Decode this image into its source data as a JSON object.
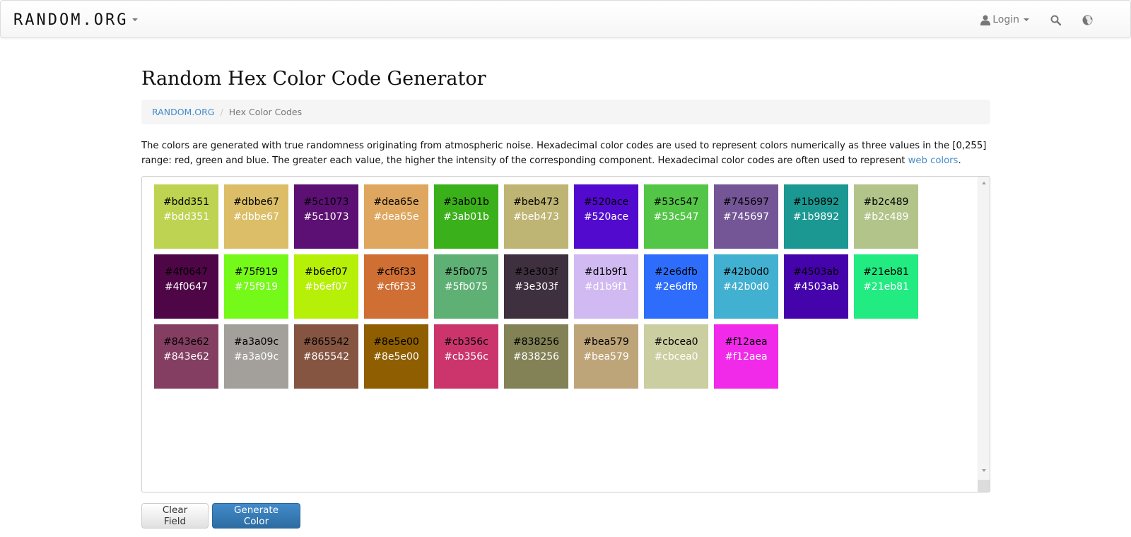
{
  "navbar": {
    "brand": "RANDOM.ORG",
    "login_label": "Login",
    "icons": [
      "user-icon",
      "search-icon",
      "globe-icon"
    ]
  },
  "page": {
    "title": "Random Hex Color Code Generator",
    "breadcrumb": {
      "home": "RANDOM.ORG",
      "separator": "/",
      "current": "Hex Color Codes"
    },
    "description_text": "The colors are generated with true randomness originating from atmospheric noise. Hexadecimal color codes are used to represent colors numerically as three values in the [0,255] range: red, green and blue. The greater each value, the higher the intensity of the corresponding component. Hexadecimal color codes are often used to represent ",
    "description_link": "web colors",
    "description_end": "."
  },
  "colors": [
    "#bdd351",
    "#dbbe67",
    "#5c1073",
    "#dea65e",
    "#3ab01b",
    "#beb473",
    "#520ace",
    "#53c547",
    "#745697",
    "#1b9892",
    "#b2c489",
    "#4f0647",
    "#75f919",
    "#b6ef07",
    "#cf6f33",
    "#5fb075",
    "#3e303f",
    "#d1b9f1",
    "#2e6dfb",
    "#42b0d0",
    "#4503ab",
    "#21eb81",
    "#843e62",
    "#a3a09c",
    "#865542",
    "#8e5e00",
    "#cb356c",
    "#838256",
    "#bea579",
    "#cbcea0",
    "#f12aea"
  ],
  "buttons": {
    "clear": "Clear Field",
    "generate": "Generate Color"
  }
}
